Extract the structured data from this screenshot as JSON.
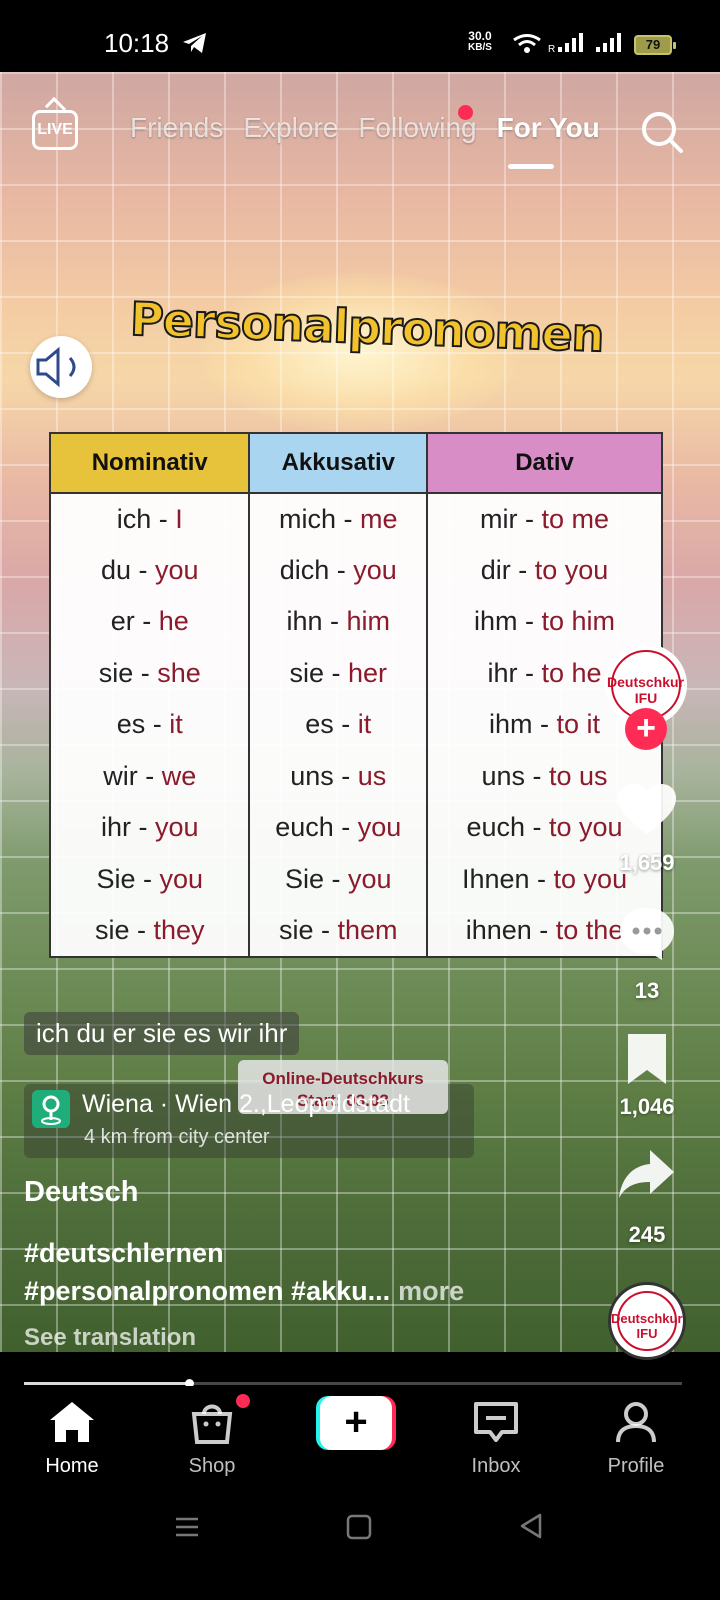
{
  "status_bar": {
    "time": "10:18",
    "speed_value": "30.0",
    "speed_unit": "KB/S",
    "signal_r": "R",
    "battery": "79"
  },
  "top_nav": {
    "live_label": "LIVE",
    "tabs": [
      {
        "label": "Friends"
      },
      {
        "label": "Explore"
      },
      {
        "label": "Following"
      },
      {
        "label": "For You"
      }
    ]
  },
  "video": {
    "title": "Personalpronomen",
    "table": {
      "headers": [
        "Nominativ",
        "Akkusativ",
        "Dativ"
      ],
      "rows": [
        [
          [
            "ich - ",
            "I"
          ],
          [
            "mich - ",
            "me"
          ],
          [
            "mir - ",
            "to me"
          ]
        ],
        [
          [
            "du - ",
            "you"
          ],
          [
            "dich - ",
            "you"
          ],
          [
            "dir - ",
            "to you"
          ]
        ],
        [
          [
            "er - ",
            "he"
          ],
          [
            "ihn - ",
            "him"
          ],
          [
            "ihm - ",
            "to him"
          ]
        ],
        [
          [
            "sie - ",
            "she"
          ],
          [
            "sie - ",
            "her"
          ],
          [
            "ihr - ",
            "to he"
          ]
        ],
        [
          [
            "es - ",
            "it"
          ],
          [
            "es - ",
            "it"
          ],
          [
            "ihm - ",
            "to it"
          ]
        ],
        [
          [
            "wir - ",
            "we"
          ],
          [
            "uns - ",
            "us"
          ],
          [
            "uns - ",
            "to us"
          ]
        ],
        [
          [
            "ihr - ",
            "you"
          ],
          [
            "euch - ",
            "you"
          ],
          [
            "euch - ",
            "to you"
          ]
        ],
        [
          [
            "Sie - ",
            "you"
          ],
          [
            "Sie - ",
            "you"
          ],
          [
            "Ihnen - ",
            "to you"
          ]
        ],
        [
          [
            "sie - ",
            "they"
          ],
          [
            "sie - ",
            "them"
          ],
          [
            "ihnen - ",
            "to the"
          ]
        ]
      ]
    },
    "subtitle": "ich du er sie es wir ihr",
    "course_badge_line1": "Online-Deutschkurs",
    "course_badge_line2": "Start: 03.03",
    "avatar_text": "Deutschkurse IFU",
    "progress_fraction": 0.25
  },
  "rail": {
    "likes": "1,659",
    "comments": "13",
    "saves": "1,046",
    "shares": "245"
  },
  "meta": {
    "location_name": "Wiena · Wien  2.,Leopoldstadt",
    "location_distance": "4 km from city center",
    "author": "Deutsch",
    "description_line1": "#deutschlernen",
    "description_line2": "#personalpronomen #akku...",
    "more_label": "more",
    "see_translation": "See translation"
  },
  "bottom_nav": {
    "home": "Home",
    "shop": "Shop",
    "create": "+",
    "inbox": "Inbox",
    "profile": "Profile"
  },
  "colors": {
    "accent": "#fe2c55",
    "teal": "#25f4ee",
    "translation_red": "#8b1a2c"
  }
}
